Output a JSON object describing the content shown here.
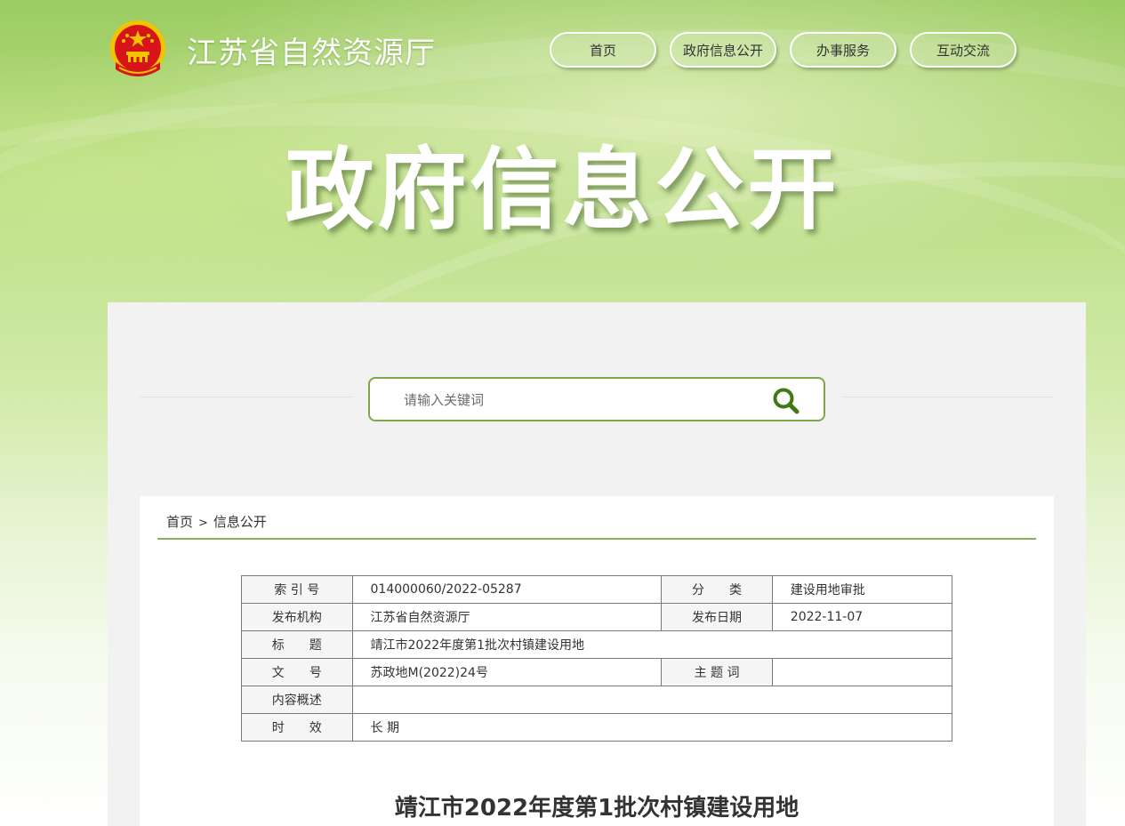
{
  "header": {
    "site_title": "江苏省自然资源厅",
    "hero_title": "政府信息公开"
  },
  "nav": [
    {
      "label": "首页"
    },
    {
      "label": "政府信息公开"
    },
    {
      "label": "办事服务"
    },
    {
      "label": "互动交流"
    }
  ],
  "search": {
    "placeholder": "请输入关键词",
    "value": ""
  },
  "breadcrumb": {
    "home": "首页",
    "separator": ">",
    "current": "信息公开"
  },
  "meta": {
    "index_label": "索 引 号",
    "index_value": "014000060/2022-05287",
    "category_label": "分　　类",
    "category_value": "建设用地审批",
    "publisher_label": "发布机构",
    "publisher_value": "江苏省自然资源厅",
    "date_label": "发布日期",
    "date_value": "2022-11-07",
    "title_label": "标　　题",
    "title_value": "靖江市2022年度第1批次村镇建设用地",
    "docno_label": "文　　号",
    "docno_value": "苏政地M(2022)24号",
    "keywords_label": "主 题 词",
    "keywords_value": "",
    "summary_label": "内容概述",
    "summary_value": "",
    "validity_label": "时　　效",
    "validity_value": "长 期"
  },
  "article": {
    "title": "靖江市2022年度第1批次村镇建设用地"
  },
  "colors": {
    "accent_green": "#7aa84a",
    "emblem_red": "#d7141a",
    "emblem_gold": "#f5c400"
  },
  "icons": {
    "emblem": "national-emblem-icon",
    "search": "search-icon"
  }
}
